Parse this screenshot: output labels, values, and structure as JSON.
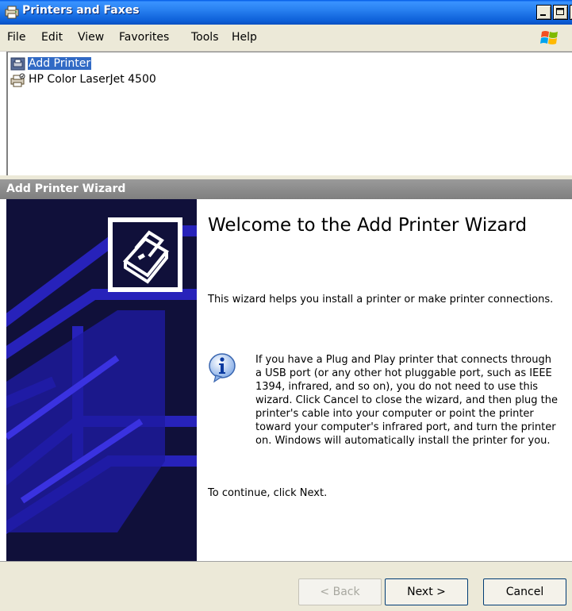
{
  "window": {
    "title": "Printers and Faxes"
  },
  "menu": {
    "items": [
      "File",
      "Edit",
      "View",
      "Favorites",
      "Tools",
      "Help"
    ]
  },
  "printers": [
    {
      "label": "Add Printer",
      "icon": "add-printer-icon",
      "selected": true
    },
    {
      "label": "HP Color LaserJet 4500",
      "icon": "printer-icon",
      "selected": false
    }
  ],
  "wizard": {
    "title": "Add Printer Wizard",
    "heading": "Welcome to the Add Printer Wizard",
    "intro": "This wizard helps you install a printer or make printer connections.",
    "info": "If you have a Plug and Play printer that connects through a USB port (or any other hot pluggable port, such as IEEE 1394, infrared, and so on), you do not need to use this wizard. Click Cancel to close the wizard, and then plug the printer's cable into your computer or point the printer toward your computer's infrared port, and turn the printer on. Windows will automatically install the printer for you.",
    "continue": "To continue, click Next.",
    "buttons": {
      "back": "< Back",
      "next": "Next >",
      "cancel": "Cancel"
    }
  },
  "colors": {
    "titlebar": "#0d5fd8",
    "selection": "#316ac5",
    "wizard_side": "#10103a",
    "wizard_side_art": "#2a24c8"
  }
}
